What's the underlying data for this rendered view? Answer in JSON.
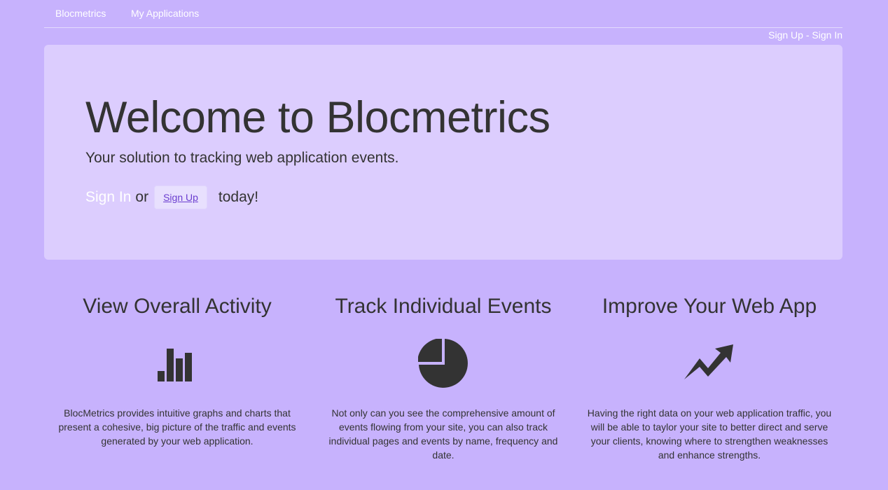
{
  "nav": {
    "brand": "Blocmetrics",
    "apps": "My Applications",
    "sign_up": "Sign Up",
    "separator": " - ",
    "sign_in": "Sign In"
  },
  "hero": {
    "title": "Welcome to Blocmetrics",
    "subtitle": "Your solution to tracking web application events.",
    "cta_sign_in": "Sign In",
    "cta_or": "or",
    "cta_sign_up": "Sign Up",
    "cta_today": "today!"
  },
  "features": [
    {
      "title": "View Overall Activity",
      "icon": "bar-chart-icon",
      "text": "BlocMetrics provides intuitive graphs and charts that present a cohesive, big picture of the traffic and events generated by your web application."
    },
    {
      "title": "Track Individual Events",
      "icon": "pie-chart-icon",
      "text": "Not only can you see the comprehensive amount of events flowing from your site, you can also track individual pages and events by name, frequency and date."
    },
    {
      "title": "Improve Your Web App",
      "icon": "trending-up-icon",
      "text": "Having the right data on your web application traffic, you will be able to taylor your site to better direct and serve your clients, knowing where to strengthen weaknesses and enhance strengths."
    }
  ],
  "colors": {
    "background": "#c7b2fd",
    "jumbotron": "#dccdfe",
    "text": "#333333",
    "link": "#ffffff",
    "button_text": "#6a3dcf"
  }
}
